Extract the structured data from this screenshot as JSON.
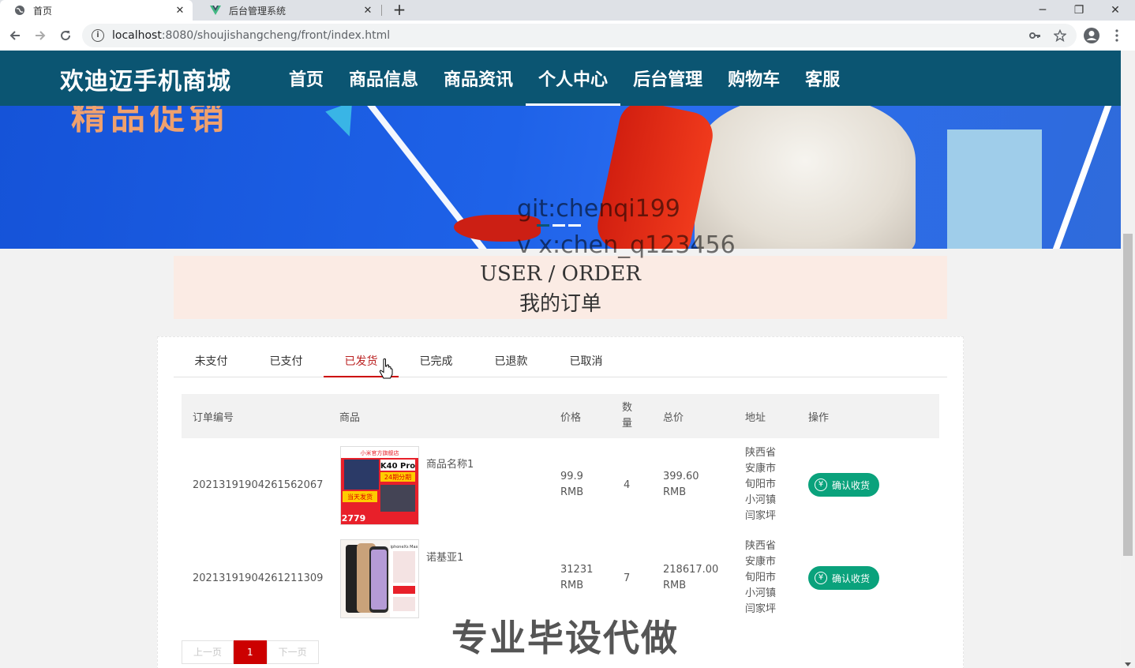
{
  "browser": {
    "tabs": [
      {
        "title": "首页",
        "active": true
      },
      {
        "title": "后台管理系统",
        "active": false
      }
    ],
    "new_tab": "+",
    "window_controls": {
      "minimize": "─",
      "restore": "❐",
      "close": "✕"
    },
    "url_host": "localhost",
    "url_rest": ":8080/shoujishangcheng/front/index.html"
  },
  "site": {
    "brand": "欢迪迈手机商城",
    "nav": [
      "首页",
      "商品信息",
      "商品资讯",
      "个人中心",
      "后台管理",
      "购物车",
      "客服"
    ],
    "active_nav": "个人中心"
  },
  "banner": {
    "text_fragment": "精品促销"
  },
  "watermarks": {
    "git": "git:chenqi199",
    "vx": "v x:chen_q123456",
    "ad": "专业毕设代做"
  },
  "title": {
    "en": "USER / ORDER",
    "zh": "我的订单"
  },
  "order_tabs": [
    "未支付",
    "已支付",
    "已发货",
    "已完成",
    "已退款",
    "已取消"
  ],
  "active_tab": "已发货",
  "table": {
    "headers": {
      "order_no": "订单编号",
      "product": "商品",
      "price": "价格",
      "qty_1": "数",
      "qty_2": "量",
      "total": "总价",
      "address": "地址",
      "action": "操作"
    },
    "rows": [
      {
        "order_no": "20213191904261562067",
        "name": "商品名称1",
        "price": "99.9",
        "price_unit": "RMB",
        "qty": "4",
        "total": "399.60",
        "total_unit": "RMB",
        "address": [
          "陕西省",
          "安康市",
          "旬阳市",
          "小河镇",
          "闫家坪"
        ],
        "action": "确认收货",
        "img_text": {
          "top": "小米官方旗舰店",
          "model": "K40 Pro",
          "promo": "24期分期",
          "ship": "当天发货",
          "price": "2779"
        }
      },
      {
        "order_no": "20213191904261211309",
        "name": "诺基亚1",
        "price": "31231",
        "price_unit": "RMB",
        "qty": "7",
        "total": "218617.00",
        "total_unit": "RMB",
        "address": [
          "陕西省",
          "安康市",
          "旬阳市",
          "小河镇",
          "闫家坪"
        ],
        "action": "确认收货",
        "img_text": {
          "top": "iphoneXs Max"
        }
      }
    ]
  },
  "pager": {
    "prev": "上一页",
    "current": "1",
    "next": "下一页"
  },
  "colors": {
    "header_bg": "#0b5572",
    "active_tab": "#cc0000",
    "confirm_btn": "#0aa27c",
    "title_box": "#fbebe4"
  },
  "icons": {
    "yen": "¥"
  }
}
